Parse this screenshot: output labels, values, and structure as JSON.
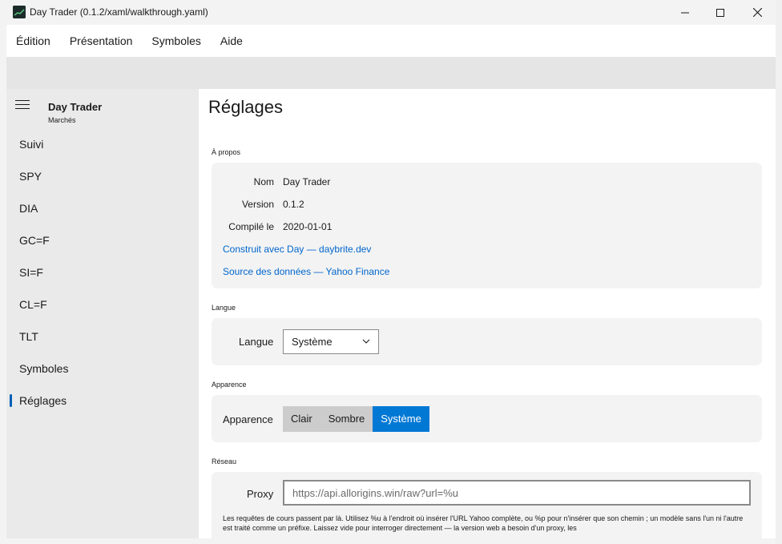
{
  "window": {
    "title": "Day Trader (0.1.2/xaml/walkthrough.yaml)",
    "accent": "#0078d4"
  },
  "menu": {
    "items": [
      "Édition",
      "Présentation",
      "Symboles",
      "Aide"
    ]
  },
  "sidebar": {
    "title": "Day Trader",
    "subtitle": "Marchés",
    "items": [
      {
        "label": "Suivi"
      },
      {
        "label": "SPY"
      },
      {
        "label": "DIA"
      },
      {
        "label": "GC=F"
      },
      {
        "label": "SI=F"
      },
      {
        "label": "CL=F"
      },
      {
        "label": "TLT"
      },
      {
        "label": "Symboles"
      },
      {
        "label": "Réglages",
        "selected": true
      }
    ]
  },
  "main": {
    "page_title": "Réglages",
    "about": {
      "section_label": "À propos",
      "name_key": "Nom",
      "name_value": "Day Trader",
      "version_key": "Version",
      "version_value": "0.1.2",
      "compiled_key": "Compilé le",
      "compiled_value": "2020-01-01",
      "link_built": "Construit avec Day — daybrite.dev",
      "link_source": "Source des données — Yahoo Finance"
    },
    "language": {
      "section_label": "Langue",
      "field_label": "Langue",
      "selected": "Système"
    },
    "appearance": {
      "section_label": "Apparence",
      "field_label": "Apparence",
      "options": [
        "Clair",
        "Sombre",
        "Système"
      ],
      "selected": "Système"
    },
    "network": {
      "section_label": "Réseau",
      "field_label": "Proxy",
      "proxy_value": "https://api.allorigins.win/raw?url=%u",
      "help_text": "Les requêtes de cours passent par là. Utilisez %u à l'endroit où insérer l'URL Yahoo complète, ou %p pour n'insérer que son chemin ; un modèle sans l'un ni l'autre est traité comme un préfixe. Laissez vide pour interroger directement — la version web a besoin d'un proxy, les"
    }
  }
}
